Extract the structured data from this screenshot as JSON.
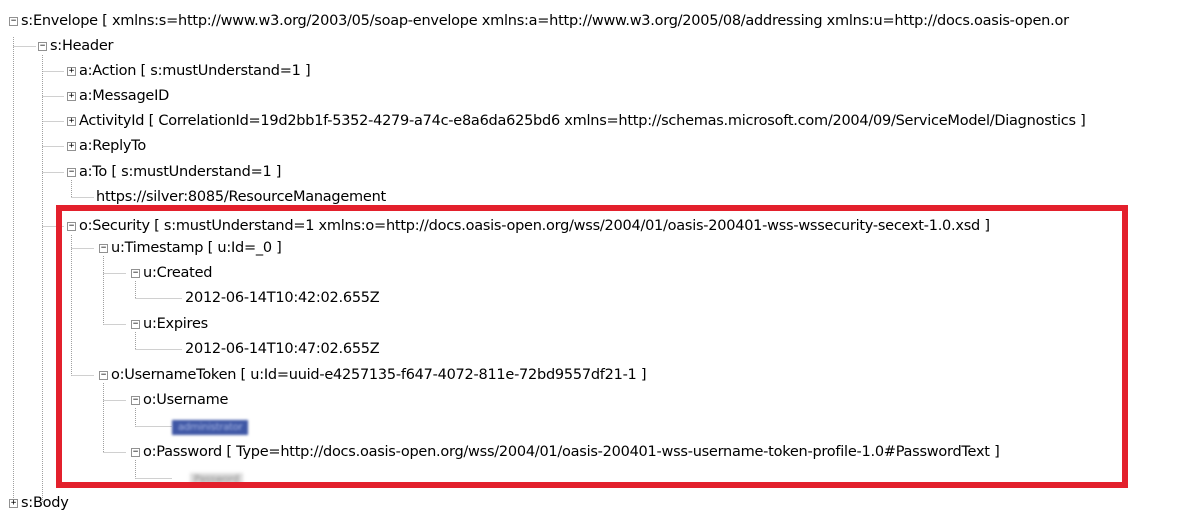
{
  "tree": {
    "envelope": {
      "label": "s:Envelope [ xmlns:s=http://www.w3.org/2003/05/soap-envelope xmlns:a=http://www.w3.org/2005/08/addressing xmlns:u=http://docs.oasis-open.or",
      "toggle": "−"
    },
    "header": {
      "label": "s:Header",
      "toggle": "−"
    },
    "action": {
      "label": "a:Action [ s:mustUnderstand=1 ]",
      "toggle": "+"
    },
    "message_id": {
      "label": "a:MessageID",
      "toggle": "+"
    },
    "activity_id": {
      "label": "ActivityId [ CorrelationId=19d2bb1f-5352-4279-a74c-e8a6da625bd6 xmlns=http://schemas.microsoft.com/2004/09/ServiceModel/Diagnostics ]",
      "toggle": "+"
    },
    "reply_to": {
      "label": "a:ReplyTo",
      "toggle": "+"
    },
    "to": {
      "label": "a:To [ s:mustUnderstand=1 ]",
      "toggle": "−"
    },
    "to_value": {
      "label": "https://silver:8085/ResourceManagement"
    },
    "security": {
      "label": "o:Security [ s:mustUnderstand=1 xmlns:o=http://docs.oasis-open.org/wss/2004/01/oasis-200401-wss-wssecurity-secext-1.0.xsd ]",
      "toggle": "−"
    },
    "timestamp": {
      "label": "u:Timestamp [ u:Id=_0 ]",
      "toggle": "−"
    },
    "created": {
      "label": "u:Created",
      "toggle": "−"
    },
    "created_value": {
      "label": "2012-06-14T10:42:02.655Z"
    },
    "expires": {
      "label": "u:Expires",
      "toggle": "−"
    },
    "expires_value": {
      "label": "2012-06-14T10:47:02.655Z"
    },
    "username_token": {
      "label": "o:UsernameToken [ u:Id=uuid-e4257135-f647-4072-811e-72bd9557df21-1 ]",
      "toggle": "−"
    },
    "username": {
      "label": "o:Username",
      "toggle": "−"
    },
    "username_value": {
      "label": "administrator"
    },
    "password": {
      "label": "o:Password [ Type=http://docs.oasis-open.org/wss/2004/01/oasis-200401-wss-username-token-profile-1.0#PasswordText ]",
      "toggle": "−"
    },
    "password_value": {
      "label": "Password"
    },
    "body": {
      "label": "s:Body",
      "toggle": "+"
    }
  },
  "colors": {
    "highlight_border": "#e3202c",
    "selection": "#3f57a5",
    "tree_lines": "#a0a0a0"
  }
}
